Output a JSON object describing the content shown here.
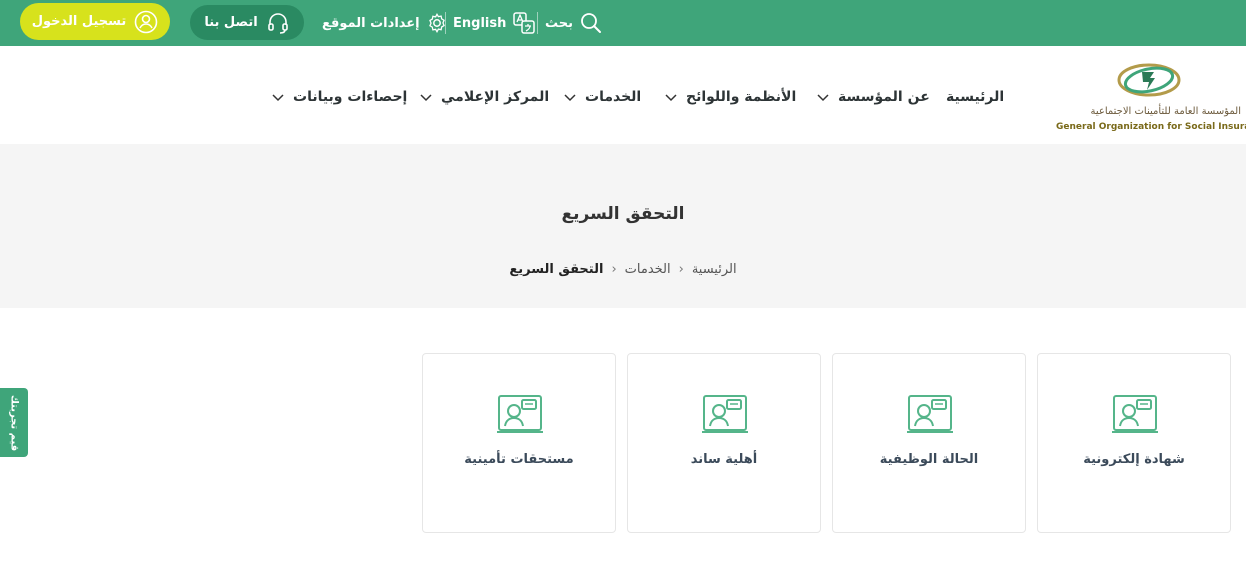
{
  "topbar": {
    "login_label": "تسجيل الدخول",
    "contact_label": "اتصل بنا",
    "settings_label": "إعدادات الموقع",
    "language_label": "English",
    "search_label": "بحث"
  },
  "logo": {
    "arabic": "المؤسسة العامة للتأمينات الاجتماعية",
    "english": "General Organization for Social Insurance"
  },
  "nav": {
    "items": [
      {
        "label": "الرئيسية"
      },
      {
        "label": "عن المؤسسة"
      },
      {
        "label": "الأنظمة واللوائح"
      },
      {
        "label": "الخدمات"
      },
      {
        "label": "المركز الإعلامي"
      },
      {
        "label": "إحصاءات وبيانات"
      }
    ]
  },
  "hero": {
    "title": "التحقق السريع",
    "breadcrumb": [
      "الرئيسية",
      "الخدمات",
      "التحقق السريع"
    ]
  },
  "cards": [
    {
      "label": "شهادة إلكترونية"
    },
    {
      "label": "الحالة الوظيفية"
    },
    {
      "label": "أهلية ساند"
    },
    {
      "label": "مستحقات تأمينية"
    }
  ],
  "side_tab": {
    "label": "قيم تجربتك"
  },
  "colors": {
    "brand_green": "#3fa57a",
    "login_yellow": "#d7e21c",
    "contact_dark": "#2a8a62"
  }
}
